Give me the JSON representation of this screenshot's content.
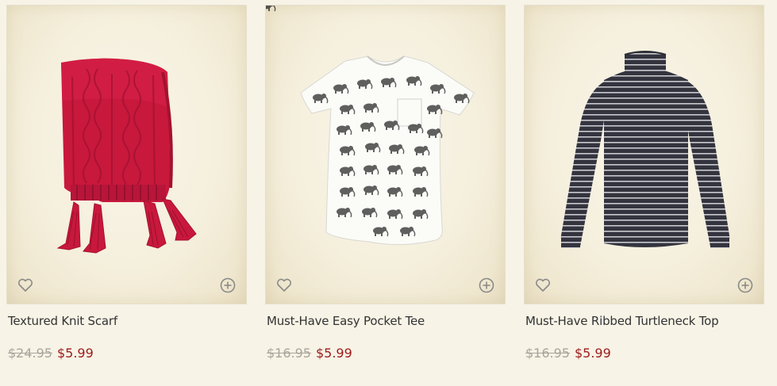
{
  "products": [
    {
      "name": "Textured Knit Scarf",
      "old_price": "$24.95",
      "sale_price": "$5.99",
      "image_icon": "red-knit-scarf",
      "wishlist_icon": "heart-outline-icon",
      "quickadd_icon": "plus-circle-icon"
    },
    {
      "name": "Must-Have Easy Pocket Tee",
      "old_price": "$16.95",
      "sale_price": "$5.99",
      "image_icon": "white-elephant-print-tee",
      "wishlist_icon": "heart-outline-icon",
      "quickadd_icon": "plus-circle-icon"
    },
    {
      "name": "Must-Have Ribbed Turtleneck Top",
      "old_price": "$16.95",
      "sale_price": "$5.99",
      "image_icon": "striped-turtleneck",
      "wishlist_icon": "heart-outline-icon",
      "quickadd_icon": "plus-circle-icon"
    }
  ],
  "colors": {
    "background": "#f7f3e6",
    "sale_price": "#9c1c1c",
    "old_price": "#a9a59c",
    "scarf": "#c8183c",
    "turtleneck": "#3a3b45"
  }
}
